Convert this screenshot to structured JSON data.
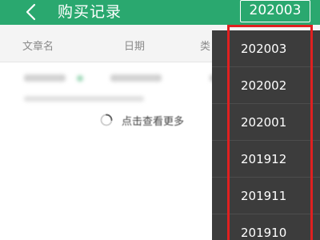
{
  "header": {
    "title": "购买记录",
    "selected_month": "202003",
    "color": "#2aa86f"
  },
  "columns": {
    "article": "文章名",
    "date": "日期",
    "type": "类"
  },
  "load_more": {
    "label": "点击查看更多"
  },
  "dropdown": {
    "options": [
      "202003",
      "202002",
      "202001",
      "201912",
      "201911",
      "201910"
    ]
  },
  "icons": {
    "back": "chevron-left-icon",
    "loading": "spinner-icon"
  },
  "colors": {
    "highlight": "#e02020",
    "dropdown_bg": "#3c3c3c"
  }
}
